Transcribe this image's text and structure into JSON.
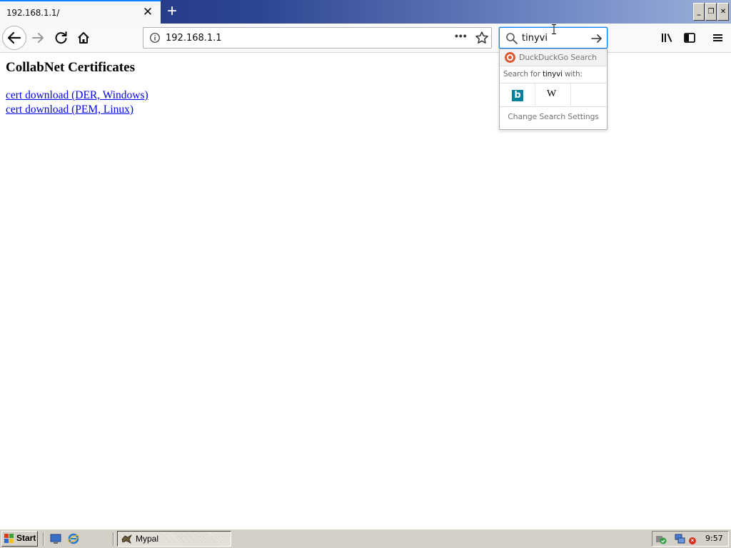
{
  "tab": {
    "title": "192.168.1.1/",
    "close_glyph": "✕",
    "new_tab_glyph": "+"
  },
  "window_controls": {
    "minimize": "_",
    "maximize": "❐",
    "close": "✕"
  },
  "navbar": {
    "url": "192.168.1.1",
    "page_actions_glyph": "•••",
    "search_value": "tinyvi"
  },
  "page": {
    "heading": "CollabNet Certificates",
    "links": [
      {
        "label": "cert download (DER, Windows)"
      },
      {
        "label": "cert download (PEM, Linux)"
      }
    ]
  },
  "search_popup": {
    "default_engine": "DuckDuckGo Search",
    "search_for_prefix": "Search for ",
    "search_term": "tinyvi",
    "search_for_suffix": " with:",
    "engines": [
      {
        "name": "Bing",
        "glyph": "b"
      },
      {
        "name": "Wikipedia",
        "glyph": "W"
      }
    ],
    "change_settings": "Change Search Settings"
  },
  "taskbar": {
    "start_label": "Start",
    "task_label": "Mypal",
    "clock": "9:57"
  },
  "colors": {
    "accent": "#0a84ff",
    "link": "#0000ee",
    "title_gradient_start": "#1e2f7a",
    "taskbar": "#d4d0c8"
  }
}
